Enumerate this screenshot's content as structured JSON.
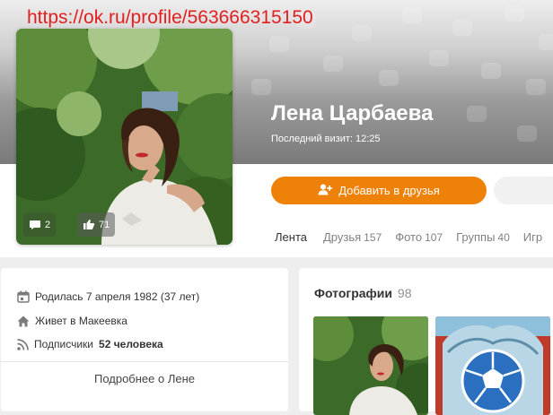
{
  "overlay_url": "https://ok.ru/profile/563666315150",
  "profile": {
    "name": "Лена Царбаева",
    "last_visit": "Последний визит: 12:25",
    "photo_comments": "2",
    "photo_likes": "71"
  },
  "actions": {
    "add_friend_label": "Добавить в друзья"
  },
  "tabs": [
    {
      "label": "Лента",
      "count": "",
      "active": true
    },
    {
      "label": "Друзья",
      "count": "157"
    },
    {
      "label": "Фото",
      "count": "107"
    },
    {
      "label": "Группы",
      "count": "40"
    },
    {
      "label": "Игр",
      "count": ""
    }
  ],
  "info": {
    "birthday": "Родилась 7 апреля 1982 (37 лет)",
    "location": "Живет в Макеевка",
    "followers_prefix": "Подписчики",
    "followers_count": "52 человека",
    "more_link": "Подробнее о Лене"
  },
  "photos": {
    "title": "Фотографии",
    "count": "98"
  },
  "colors": {
    "accent": "#ee8208",
    "url_red": "#e02020",
    "page_bg": "#eeeeee"
  },
  "icons": [
    "comment-icon",
    "like-icon",
    "add-user-icon",
    "calendar-icon",
    "home-icon",
    "rss-icon",
    "soccer-ball-icon"
  ]
}
